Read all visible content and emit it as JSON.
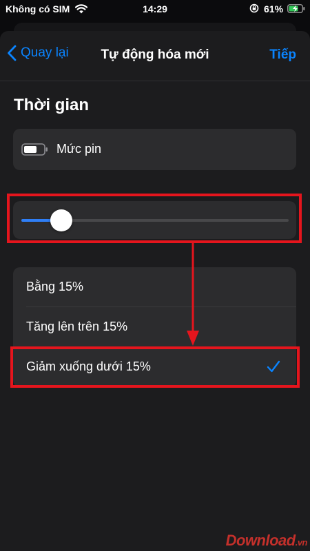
{
  "status_bar": {
    "carrier": "Không có SIM",
    "time": "14:29",
    "battery_percent": "61%",
    "icons": [
      "wifi-icon",
      "orientation-lock-icon",
      "battery-charging-icon"
    ]
  },
  "nav": {
    "back_label": "Quay lại",
    "title": "Tự động hóa mới",
    "next_label": "Tiếp"
  },
  "section_title": "Thời gian",
  "trigger": {
    "label": "Mức pin",
    "icon": "battery-icon"
  },
  "slider": {
    "value_percent": 15,
    "fill_color": "#2f7ff7"
  },
  "options": [
    {
      "label": "Bằng 15%",
      "selected": false
    },
    {
      "label": "Tăng lên trên 15%",
      "selected": false
    },
    {
      "label": "Giảm xuống dưới 15%",
      "selected": true
    }
  ],
  "colors": {
    "accent": "#0a84ff",
    "annotation": "#e5151d"
  },
  "watermark": {
    "text": "Download",
    "suffix": ".vn"
  }
}
